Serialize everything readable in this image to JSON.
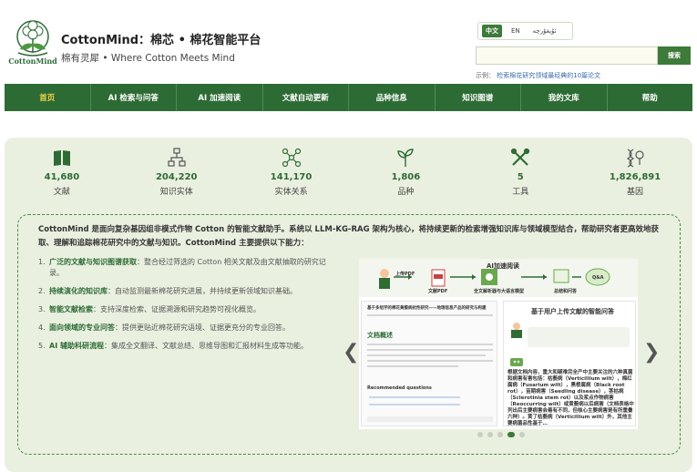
{
  "header": {
    "logo_caption": "CottonMind",
    "title": "CottonMind：棉芯 • 棉花智能平台",
    "subtitle": "棉有灵犀 • Where Cotton Meets Mind"
  },
  "language": {
    "options": [
      "中文",
      "EN",
      "ئۇيغۇرچە"
    ],
    "active": "中文"
  },
  "search": {
    "value": "",
    "button_label": "搜索",
    "example_prefix": "示例：",
    "example_query": "检索棉花研究领域最经典的10篇论文"
  },
  "nav": {
    "items": [
      "首页",
      "AI 检索与问答",
      "AI 加速阅读",
      "文献自动更新",
      "品种信息",
      "知识图谱",
      "我的文库",
      "帮助"
    ],
    "active_index": 0
  },
  "stats": [
    {
      "icon": "book-icon",
      "value": "41,680",
      "label": "文献"
    },
    {
      "icon": "hierarchy-icon",
      "value": "204,220",
      "label": "知识实体"
    },
    {
      "icon": "network-icon",
      "value": "141,170",
      "label": "实体关系"
    },
    {
      "icon": "sprout-icon",
      "value": "1,806",
      "label": "品种"
    },
    {
      "icon": "tools-icon",
      "value": "5",
      "label": "工具"
    },
    {
      "icon": "dna-icon",
      "value": "1,826,891",
      "label": "基因"
    }
  ],
  "intro": "CottonMind 是面向复杂基因组非模式作物 Cotton 的智能文献助手。系统以 LLM-KG-RAG 架构为核心，将持续更新的检索增强知识库与领域模型结合，帮助研究者更高效地获取、理解和追踪棉花研究中的文献与知识。CottonMind 主要提供以下能力：",
  "features": [
    {
      "num": "1.",
      "title": "广泛的文献与知识图谱获取",
      "desc": "：整合经过筛选的 Cotton 相关文献及由文献抽取的研究记录。"
    },
    {
      "num": "2.",
      "title": "持续演化的知识库",
      "desc": "：自动监测最新棉花研究进展，并持续更新领域知识基础。"
    },
    {
      "num": "3.",
      "title": "智能文献检索",
      "desc": "：支持深度检索、证据溯源和研究趋势可视化概览。"
    },
    {
      "num": "4.",
      "title": "面向领域的专业问答",
      "desc": "：提供更贴近棉花研究语境、证据更充分的专业回答。"
    },
    {
      "num": "5.",
      "title": "AI 辅助科研流程",
      "desc": "：集成全文翻译、文献总结、思维导图和汇报材料生成等功能。"
    }
  ],
  "carousel": {
    "flow_title": "AI加速阅读",
    "flow_steps": [
      "上传PDF",
      "文献PDF",
      "全文解析器与大语言模型",
      "总结和问答"
    ],
    "qa_badge": "Q&A",
    "doc_header": "基于多组学的棉花黄萎病抗性研究——地理信息产品的研究与构建",
    "doc_section": "文档概述",
    "doc_recommend": "Recommended questions",
    "chat_title": "基于用户上传文献的智能问答",
    "chat_answer": "根据文档内容，重大和疑难完全产中主要关注的六种真菌和病害有害包括：枯萎病（Verticillium wilt），棉红腐病（Fusarium wilt），黑根腐病（Black root rot），苗期病害（Seedling disease），茎枯病（Sclerotinia stem rot）以及浆点作物病害（Reoccurring wilt）或黄萎病以后病害（文档表格中列出后主要病害会着有不同，但核心主要病害是有所重叠六种）。黄了枯萎病（Verticillium wilt）外，其他主要病菌品性基于…",
    "slide_count": 5,
    "active_slide": 3
  }
}
